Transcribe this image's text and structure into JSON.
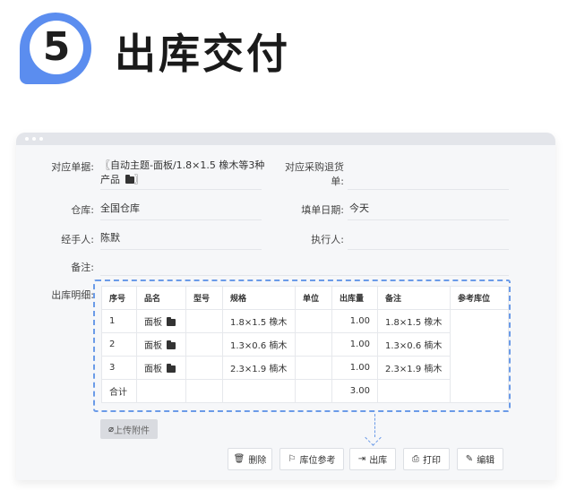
{
  "header": {
    "step_number": "5",
    "title": "出库交付"
  },
  "form": {
    "order_label": "对应单据:",
    "order_value": "〖自动主题-面板/1.8×1.5 橡木等3种",
    "order_value_line2": "产品",
    "order_value_close": "〗",
    "purchase_return_label_1": "对应采购退货",
    "purchase_return_label_2": "单:",
    "warehouse_label": "仓库:",
    "warehouse_value": "全国仓库",
    "date_label": "填单日期:",
    "date_value": "今天",
    "handler_label": "经手人:",
    "handler_value": "陈默",
    "executor_label": "执行人:",
    "remark_label": "备注:",
    "detail_label": "出库明细:"
  },
  "table": {
    "headers": [
      "序号",
      "品名",
      "型号",
      "规格",
      "单位",
      "出库量",
      "备注",
      "参考库位"
    ],
    "rows": [
      {
        "seq": "1",
        "name": "面板",
        "spec": "1.8×1.5 橡木",
        "qty": "1.00",
        "remark": "1.8×1.5 橡木"
      },
      {
        "seq": "2",
        "name": "面板",
        "spec": "1.3×0.6 楠木",
        "qty": "1.00",
        "remark": "1.3×0.6 楠木"
      },
      {
        "seq": "3",
        "name": "面板",
        "spec": "2.3×1.9 楠木",
        "qty": "1.00",
        "remark": "2.3×1.9 楠木"
      }
    ],
    "total_label": "合计",
    "total_qty": "3.00"
  },
  "upload_label": "上传附件",
  "actions": {
    "delete": "删除",
    "location_ref": "库位参考",
    "outbound": "出库",
    "print": "打印",
    "edit": "编辑"
  },
  "colors": {
    "accent": "#5b8def",
    "dashed": "#6b9be8"
  },
  "icons": [
    "trash-icon",
    "bookmark-icon",
    "exit-icon",
    "printer-icon",
    "pencil-icon",
    "folder-icon",
    "paperclip-icon"
  ]
}
